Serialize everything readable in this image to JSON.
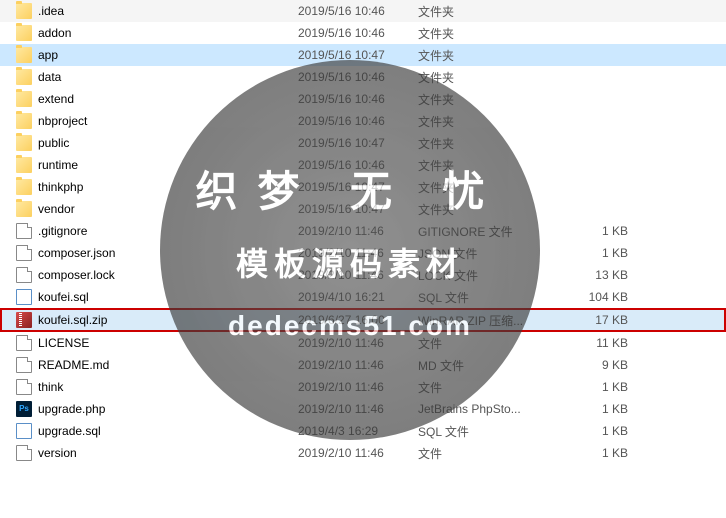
{
  "watermark": {
    "line1": "织梦 无 忧",
    "line2": "模板源码素材",
    "line3": "dedecms51.com"
  },
  "files": [
    {
      "name": ".idea",
      "date": "2019/5/16 10:46",
      "type": "文件夹",
      "size": "",
      "icon": "folder",
      "selected": false,
      "highlighted": false
    },
    {
      "name": "addon",
      "date": "2019/5/16 10:46",
      "type": "文件夹",
      "size": "",
      "icon": "folder",
      "selected": false,
      "highlighted": false
    },
    {
      "name": "app",
      "date": "2019/5/16 10:47",
      "type": "文件夹",
      "size": "",
      "icon": "folder",
      "selected": true,
      "highlighted": false
    },
    {
      "name": "data",
      "date": "2019/5/16 10:46",
      "type": "文件夹",
      "size": "",
      "icon": "folder",
      "selected": false,
      "highlighted": false
    },
    {
      "name": "extend",
      "date": "2019/5/16 10:46",
      "type": "文件夹",
      "size": "",
      "icon": "folder",
      "selected": false,
      "highlighted": false
    },
    {
      "name": "nbproject",
      "date": "2019/5/16 10:46",
      "type": "文件夹",
      "size": "",
      "icon": "folder",
      "selected": false,
      "highlighted": false
    },
    {
      "name": "public",
      "date": "2019/5/16 10:47",
      "type": "文件夹",
      "size": "",
      "icon": "folder",
      "selected": false,
      "highlighted": false
    },
    {
      "name": "runtime",
      "date": "2019/5/16 10:46",
      "type": "文件夹",
      "size": "",
      "icon": "folder",
      "selected": false,
      "highlighted": false
    },
    {
      "name": "thinkphp",
      "date": "2019/5/16 10:47",
      "type": "文件夹",
      "size": "",
      "icon": "folder",
      "selected": false,
      "highlighted": false
    },
    {
      "name": "vendor",
      "date": "2019/5/16 10:47",
      "type": "文件夹",
      "size": "",
      "icon": "folder",
      "selected": false,
      "highlighted": false
    },
    {
      "name": ".gitignore",
      "date": "2019/2/10 11:46",
      "type": "GITIGNORE 文件",
      "size": "1 KB",
      "icon": "file",
      "selected": false,
      "highlighted": false
    },
    {
      "name": "composer.json",
      "date": "2019/2/10 11:46",
      "type": "JSON 文件",
      "size": "1 KB",
      "icon": "file",
      "selected": false,
      "highlighted": false
    },
    {
      "name": "composer.lock",
      "date": "2019/2/10 11:46",
      "type": "LOCK 文件",
      "size": "13 KB",
      "icon": "file",
      "selected": false,
      "highlighted": false
    },
    {
      "name": "koufei.sql",
      "date": "2019/4/10 16:21",
      "type": "SQL 文件",
      "size": "104 KB",
      "icon": "sql",
      "selected": false,
      "highlighted": false
    },
    {
      "name": "koufei.sql.zip",
      "date": "2019/6/27 16:00",
      "type": "WinRAR ZIP 压缩...",
      "size": "17 KB",
      "icon": "zip",
      "selected": false,
      "highlighted": true
    },
    {
      "name": "LICENSE",
      "date": "2019/2/10 11:46",
      "type": "文件",
      "size": "11 KB",
      "icon": "file",
      "selected": false,
      "highlighted": false
    },
    {
      "name": "README.md",
      "date": "2019/2/10 11:46",
      "type": "MD 文件",
      "size": "9 KB",
      "icon": "file",
      "selected": false,
      "highlighted": false
    },
    {
      "name": "think",
      "date": "2019/2/10 11:46",
      "type": "文件",
      "size": "1 KB",
      "icon": "file",
      "selected": false,
      "highlighted": false
    },
    {
      "name": "upgrade.php",
      "date": "2019/2/10 11:46",
      "type": "JetBrains PhpSto...",
      "size": "1 KB",
      "icon": "ps",
      "selected": false,
      "highlighted": false
    },
    {
      "name": "upgrade.sql",
      "date": "2019/4/3 16:29",
      "type": "SQL 文件",
      "size": "1 KB",
      "icon": "sql",
      "selected": false,
      "highlighted": false
    },
    {
      "name": "version",
      "date": "2019/2/10 11:46",
      "type": "文件",
      "size": "1 KB",
      "icon": "file",
      "selected": false,
      "highlighted": false
    }
  ]
}
